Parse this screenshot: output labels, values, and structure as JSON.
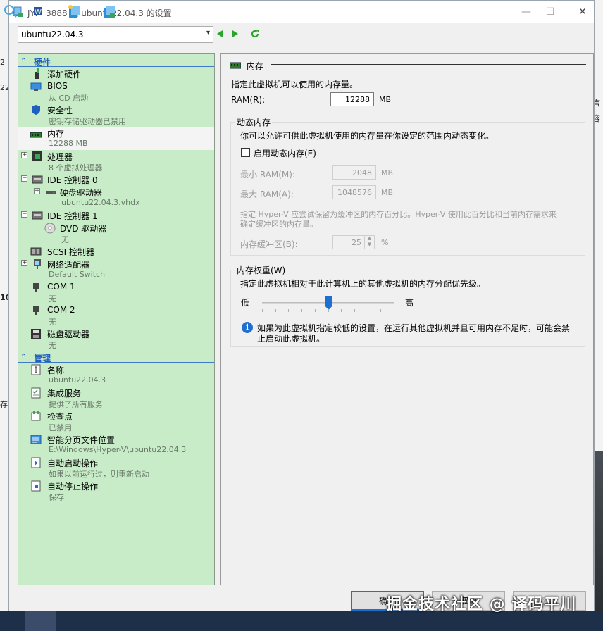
{
  "window": {
    "title": "JY213888 上 ubuntu22.04.3 的设置",
    "minimize": "—",
    "maximize": "☐",
    "close": "✕"
  },
  "toolbar": {
    "vm_selected": "ubuntu22.04.3"
  },
  "background": {
    "frag1": "2",
    "frag2": "22",
    "frag3": "10",
    "frag4": "存",
    "frag5": "言",
    "frag6": "容"
  },
  "tree": {
    "hardware_header": "硬件",
    "management_header": "管理",
    "items": [
      {
        "name": "添加硬件",
        "sub": ""
      },
      {
        "name": "BIOS",
        "sub": "从 CD 启动"
      },
      {
        "name": "安全性",
        "sub": "密钥存储驱动器已禁用"
      },
      {
        "name": "内存",
        "sub": "12288 MB"
      },
      {
        "name": "处理器",
        "sub": "8 个虚拟处理器"
      },
      {
        "name": "IDE 控制器 0",
        "sub": ""
      },
      {
        "name": "硬盘驱动器",
        "sub": "ubuntu22.04.3.vhdx"
      },
      {
        "name": "IDE 控制器 1",
        "sub": ""
      },
      {
        "name": "DVD 驱动器",
        "sub": "无"
      },
      {
        "name": "SCSI 控制器",
        "sub": ""
      },
      {
        "name": "网络适配器",
        "sub": "Default Switch"
      },
      {
        "name": "COM 1",
        "sub": "无"
      },
      {
        "name": "COM 2",
        "sub": "无"
      },
      {
        "name": "磁盘驱动器",
        "sub": "无"
      }
    ],
    "mgmt_items": [
      {
        "name": "名称",
        "sub": "ubuntu22.04.3"
      },
      {
        "name": "集成服务",
        "sub": "提供了所有服务"
      },
      {
        "name": "检查点",
        "sub": "已禁用"
      },
      {
        "name": "智能分页文件位置",
        "sub": "E:\\Windows\\Hyper-V\\ubuntu22.04.3"
      },
      {
        "name": "自动启动操作",
        "sub": "如果以前运行过，则重新启动"
      },
      {
        "name": "自动停止操作",
        "sub": "保存"
      }
    ]
  },
  "memory": {
    "title": "内存",
    "intro": "指定此虚拟机可以使用的内存量。",
    "ram_label": "RAM(R):",
    "ram_value": "12288",
    "ram_unit": "MB",
    "dynamic": {
      "group_label": "动态内存",
      "desc": "你可以允许可供此虚拟机使用的内存量在你设定的范围内动态变化。",
      "enable_label": "启用动态内存(E)",
      "enabled": false,
      "min_label": "最小 RAM(M):",
      "min_value": "2048",
      "min_unit": "MB",
      "max_label": "最大 RAM(A):",
      "max_value": "1048576",
      "max_unit": "MB",
      "buffer_desc1": "指定 Hyper-V 应尝试保留为缓冲区的内存百分比。Hyper-V 使用此百分比和当前内存需求来",
      "buffer_desc2": "确定缓冲区的内存量。",
      "buffer_label": "内存缓冲区(B):",
      "buffer_value": "25",
      "buffer_unit": "%"
    },
    "weight": {
      "group_label": "内存权重(W)",
      "desc": "指定此虚拟机相对于此计算机上的其他虚拟机的内存分配优先级。",
      "low": "低",
      "high": "高",
      "slider_fraction": 0.5,
      "info_line1": "如果为此虚拟机指定较低的设置，在运行其他虚拟机并且可用内存不足时，可能会禁",
      "info_line2": "止启动此虚拟机。"
    }
  },
  "buttons": {
    "ok": "确定",
    "cancel": "取消",
    "apply": "应用"
  },
  "watermark": "掘金技术社区 @ 译码平川",
  "colors": {
    "tree_bg": "#c8ecc8",
    "accent": "#1f6fd0",
    "taskbar": "#1e2f4a"
  }
}
